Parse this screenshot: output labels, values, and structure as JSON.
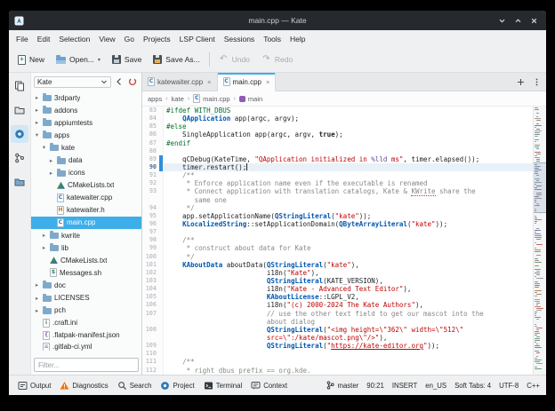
{
  "window": {
    "title": "main.cpp — Kate",
    "controls": [
      {
        "name": "minimize"
      },
      {
        "name": "maximize"
      },
      {
        "name": "close"
      }
    ]
  },
  "menubar": {
    "items": [
      "File",
      "Edit",
      "Selection",
      "View",
      "Go",
      "Projects",
      "LSP Client",
      "Sessions",
      "Tools",
      "Help"
    ]
  },
  "toolbar": {
    "buttons": [
      {
        "icon": "doc-new",
        "label": "New"
      },
      {
        "icon": "folder-open",
        "label": "Open...",
        "dropdown": true
      },
      {
        "icon": "save",
        "label": "Save"
      },
      {
        "icon": "save-as",
        "label": "Save As..."
      },
      {
        "sep": true
      },
      {
        "icon": "undo",
        "label": "Undo",
        "disabled": true
      },
      {
        "icon": "redo",
        "label": "Redo",
        "disabled": true
      }
    ]
  },
  "sidebar": {
    "tools": [
      {
        "name": "documents"
      },
      {
        "name": "filesystem"
      },
      {
        "name": "projects",
        "active": true
      },
      {
        "name": "git"
      },
      {
        "name": "files"
      }
    ]
  },
  "project_panel": {
    "project": "Kate",
    "actions": [
      {
        "name": "back"
      },
      {
        "name": "reload"
      }
    ],
    "filter_placeholder": "Filter...",
    "tree": [
      {
        "label": "3rdparty",
        "depth": 0,
        "icon": "folder",
        "arrow": "collapsed"
      },
      {
        "label": "addons",
        "depth": 0,
        "icon": "folder",
        "arrow": "collapsed"
      },
      {
        "label": "appiumtests",
        "depth": 0,
        "icon": "folder",
        "arrow": "collapsed"
      },
      {
        "label": "apps",
        "depth": 0,
        "icon": "folder",
        "arrow": "expanded"
      },
      {
        "label": "kate",
        "depth": 1,
        "icon": "folder",
        "arrow": "expanded"
      },
      {
        "label": "data",
        "depth": 2,
        "icon": "folder",
        "arrow": "collapsed"
      },
      {
        "label": "icons",
        "depth": 2,
        "icon": "folder",
        "arrow": "collapsed"
      },
      {
        "label": "CMakeLists.txt",
        "depth": 2,
        "icon": "cmake"
      },
      {
        "label": "katewaiter.cpp",
        "depth": 2,
        "icon": "cpp"
      },
      {
        "label": "katewaiter.h",
        "depth": 2,
        "icon": "h"
      },
      {
        "label": "main.cpp",
        "depth": 2,
        "icon": "cpp",
        "selected": true
      },
      {
        "label": "kwrite",
        "depth": 1,
        "icon": "folder",
        "arrow": "collapsed"
      },
      {
        "label": "lib",
        "depth": 1,
        "icon": "folder",
        "arrow": "collapsed"
      },
      {
        "label": "CMakeLists.txt",
        "depth": 1,
        "icon": "cmake"
      },
      {
        "label": "Messages.sh",
        "depth": 1,
        "icon": "script"
      },
      {
        "label": "doc",
        "depth": 0,
        "icon": "folder",
        "arrow": "collapsed"
      },
      {
        "label": "LICENSES",
        "depth": 0,
        "icon": "folder",
        "arrow": "collapsed"
      },
      {
        "label": "pch",
        "depth": 0,
        "icon": "folder",
        "arrow": "collapsed"
      },
      {
        "label": ".craft.ini",
        "depth": 0,
        "icon": "config"
      },
      {
        "label": ".flatpak-manifest.json",
        "depth": 0,
        "icon": "json"
      },
      {
        "label": ".gitlab-ci.yml",
        "depth": 0,
        "icon": "text",
        "partial": true
      }
    ]
  },
  "tabs": {
    "items": [
      {
        "icon": "cpp",
        "label": "katewaiter.cpp",
        "active": false
      },
      {
        "icon": "cpp",
        "label": "main.cpp",
        "active": true
      }
    ],
    "actions": [
      {
        "name": "new-tab",
        "icon": "plus"
      },
      {
        "name": "tab-overflow",
        "icon": "overflow"
      }
    ]
  },
  "breadcrumb": {
    "segments": [
      {
        "label": "apps"
      },
      {
        "label": "kate"
      },
      {
        "icon": "cpp",
        "label": "main.cpp"
      },
      {
        "icon": "symbol",
        "label": "main"
      }
    ]
  },
  "editor": {
    "current_line": "90",
    "cursor_position": "90:21",
    "rows": [
      {
        "n": "83",
        "s": [
          [
            "#ifdef WITH_DBUS",
            "pp"
          ]
        ]
      },
      {
        "n": "84",
        "s": [
          [
            "    ",
            "df"
          ],
          [
            "QApplication",
            "ty"
          ],
          [
            " app(argc, argv);",
            "df"
          ]
        ]
      },
      {
        "n": "85",
        "s": [
          [
            "#else",
            "pp"
          ]
        ]
      },
      {
        "n": "86",
        "s": [
          [
            "    SingleApplication app(argc, argv, ",
            "df"
          ],
          [
            "true",
            "kwd"
          ],
          [
            ");",
            "df"
          ]
        ]
      },
      {
        "n": "87",
        "s": [
          [
            "#endif",
            "pp"
          ]
        ]
      },
      {
        "n": "88",
        "s": []
      },
      {
        "n": "89",
        "mark": true,
        "s": [
          [
            "    qCDebug(KateTime, ",
            "df"
          ],
          [
            "\"",
            "st"
          ],
          [
            "QApplication",
            "stsp"
          ],
          [
            " initialized in ",
            "st"
          ],
          [
            "%lld",
            "fmt"
          ],
          [
            " ms\"",
            "st"
          ],
          [
            ", timer.elapsed());",
            "df"
          ]
        ]
      },
      {
        "n": "90",
        "cur": true,
        "cursor": true,
        "mark": true,
        "s": [
          [
            "    timer.restart();",
            "df"
          ]
        ]
      },
      {
        "n": "91",
        "s": [
          [
            "    ",
            "df"
          ],
          [
            "/**",
            "dc"
          ]
        ]
      },
      {
        "n": "92",
        "s": [
          [
            "     * Enforce application name even if the executable is renamed",
            "dc"
          ]
        ]
      },
      {
        "n": "93",
        "s": [
          [
            "     * Connect application with translation catalogs, Kate & ",
            "dc"
          ],
          [
            "KWrite",
            "dcu"
          ],
          [
            " share the",
            "dc"
          ]
        ]
      },
      {
        "n": "",
        "s": [
          [
            "       same one",
            "dc"
          ]
        ]
      },
      {
        "n": "94",
        "s": [
          [
            "     */",
            "dc"
          ]
        ]
      },
      {
        "n": "95",
        "s": [
          [
            "    app.setApplicationName(",
            "df"
          ],
          [
            "QStringLiteral",
            "ty"
          ],
          [
            "(",
            "df"
          ],
          [
            "\"kate\"",
            "stsp"
          ],
          [
            "));",
            "df"
          ]
        ]
      },
      {
        "n": "96",
        "s": [
          [
            "    ",
            "df"
          ],
          [
            "KLocalizedString",
            "ty"
          ],
          [
            "::setApplicationDomain(",
            "df"
          ],
          [
            "QByteArrayLiteral",
            "ty"
          ],
          [
            "(",
            "df"
          ],
          [
            "\"kate\"",
            "stsp"
          ],
          [
            "));",
            "df"
          ]
        ]
      },
      {
        "n": "97",
        "s": []
      },
      {
        "n": "98",
        "s": [
          [
            "    ",
            "df"
          ],
          [
            "/**",
            "dc"
          ]
        ]
      },
      {
        "n": "99",
        "s": [
          [
            "     * construct about data for Kate",
            "dc"
          ]
        ]
      },
      {
        "n": "100",
        "s": [
          [
            "     */",
            "dc"
          ]
        ]
      },
      {
        "n": "101",
        "s": [
          [
            "    ",
            "df"
          ],
          [
            "KAboutData",
            "ty"
          ],
          [
            " aboutData(",
            "df"
          ],
          [
            "QStringLiteral",
            "ty"
          ],
          [
            "(",
            "df"
          ],
          [
            "\"kate\"",
            "stsp"
          ],
          [
            "),",
            "df"
          ]
        ]
      },
      {
        "n": "102",
        "s": [
          [
            "                         i18n(",
            "df"
          ],
          [
            "\"Kate\"",
            "st"
          ],
          [
            "),",
            "df"
          ]
        ]
      },
      {
        "n": "103",
        "s": [
          [
            "                         ",
            "df"
          ],
          [
            "QStringLiteral",
            "ty"
          ],
          [
            "(KATE_VERSION),",
            "df"
          ]
        ]
      },
      {
        "n": "104",
        "s": [
          [
            "                         i18n(",
            "df"
          ],
          [
            "\"Kate - Advanced Text Editor\"",
            "st"
          ],
          [
            "),",
            "df"
          ]
        ]
      },
      {
        "n": "105",
        "s": [
          [
            "                         ",
            "df"
          ],
          [
            "KAboutLicense",
            "ty"
          ],
          [
            "::LGPL_V2,",
            "df"
          ]
        ]
      },
      {
        "n": "106",
        "s": [
          [
            "                         i18n(",
            "df"
          ],
          [
            "\"(c) 2000-2024 The Kate Authors\"",
            "st"
          ],
          [
            "),",
            "df"
          ]
        ]
      },
      {
        "n": "107",
        "s": [
          [
            "                         ",
            "df"
          ],
          [
            "// use the other text field to get our mascot into the",
            "cm"
          ]
        ]
      },
      {
        "n": "",
        "s": [
          [
            "                         about dialog",
            "cm"
          ]
        ]
      },
      {
        "n": "108",
        "s": [
          [
            "                         ",
            "df"
          ],
          [
            "QStringLiteral",
            "ty"
          ],
          [
            "(",
            "df"
          ],
          [
            "\"<img height=\\\"362\\\" width=\\\"512\\\"",
            "st"
          ]
        ]
      },
      {
        "n": "",
        "s": [
          [
            "                         src=\\\":/kate/mascot.png\\\"/>\"",
            "st"
          ],
          [
            "),",
            "df"
          ]
        ]
      },
      {
        "n": "109",
        "s": [
          [
            "                         ",
            "df"
          ],
          [
            "QStringLiteral",
            "ty"
          ],
          [
            "(",
            "df"
          ],
          [
            "\"",
            "st"
          ],
          [
            "https://kate-editor.org",
            "stu"
          ],
          [
            "\"",
            "st"
          ],
          [
            "));",
            "df"
          ]
        ]
      },
      {
        "n": "110",
        "s": []
      },
      {
        "n": "111",
        "s": [
          [
            "    ",
            "df"
          ],
          [
            "/**",
            "dc"
          ]
        ]
      },
      {
        "n": "112",
        "s": [
          [
            "     * right ",
            "dc"
          ],
          [
            "dbus",
            "dcu"
          ],
          [
            " prefix == org.kde.",
            "dc"
          ]
        ]
      }
    ]
  },
  "statusbar": {
    "buttons": [
      {
        "icon": "output",
        "label": "Output"
      },
      {
        "icon": "warning",
        "label": "Diagnostics"
      },
      {
        "icon": "search",
        "label": "Search"
      },
      {
        "icon": "project",
        "label": "Project"
      },
      {
        "icon": "terminal",
        "label": "Terminal"
      },
      {
        "icon": "context",
        "label": "Context"
      }
    ],
    "right": [
      {
        "name": "git-branch",
        "icon": "git-branch",
        "text": "master"
      },
      {
        "name": "cursor-position",
        "text": "90:21"
      },
      {
        "name": "input-mode",
        "text": "INSERT"
      },
      {
        "name": "dictionary",
        "text": "en_US"
      },
      {
        "name": "indent-mode",
        "text": "Soft Tabs: 4"
      },
      {
        "name": "encoding",
        "text": "UTF-8"
      },
      {
        "name": "highlight-mode",
        "text": "C++"
      }
    ]
  },
  "colors": {
    "accent": "#3daee9",
    "titlebar": "#26292d",
    "chrome": "#eff0f1",
    "preprocessor_green": "#006e28",
    "type_blue": "#0057ae",
    "string_red": "#bf0303",
    "comment_gray": "#898887",
    "warning_orange": "#f67400",
    "current_line": "#e9f1f8",
    "selection_blue": "#3daee9"
  }
}
